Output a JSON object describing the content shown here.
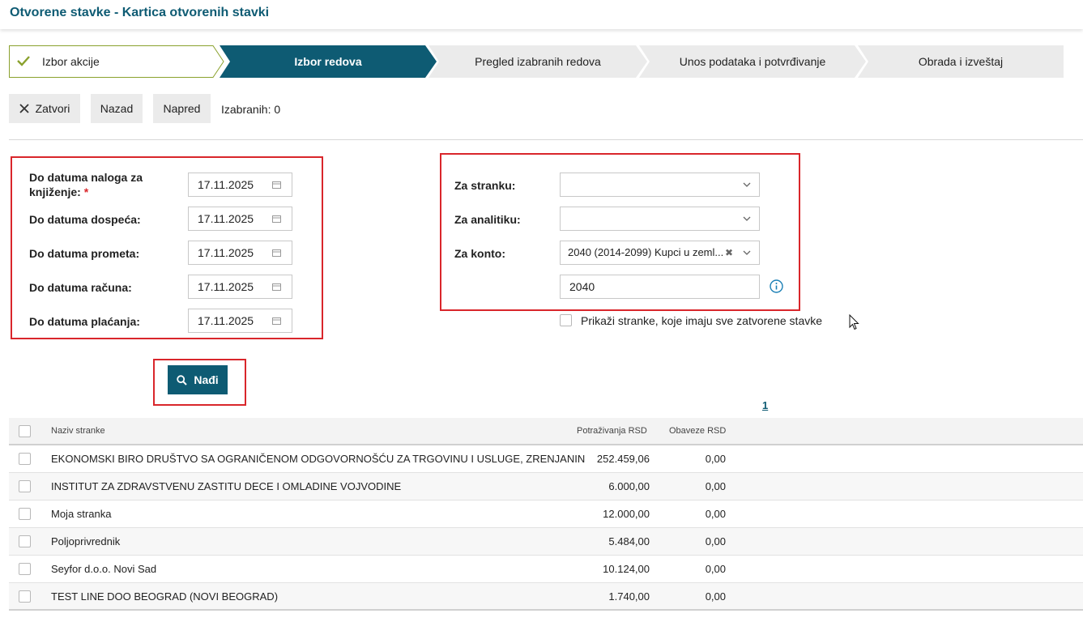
{
  "page": {
    "title": "Otvorene stavke - Kartica otvorenih stavki"
  },
  "wizard": {
    "steps": [
      {
        "label": "Izbor akcije",
        "state": "done"
      },
      {
        "label": "Izbor redova",
        "state": "active"
      },
      {
        "label": "Pregled izabranih redova",
        "state": "pending"
      },
      {
        "label": "Unos podataka i potvrđivanje",
        "state": "pending"
      },
      {
        "label": "Obrada i izveštaj",
        "state": "pending"
      }
    ]
  },
  "toolbar": {
    "close_label": "Zatvori",
    "back_label": "Nazad",
    "next_label": "Napred",
    "selected_label": "Izabranih: 0"
  },
  "dates": {
    "posting_label_1": "Do datuma naloga za",
    "posting_label_2": "knjiženje:",
    "posting_required": "*",
    "posting_value": "17.11.2025",
    "due_label": "Do datuma dospeća:",
    "due_value": "17.11.2025",
    "turnover_label": "Do datuma prometa:",
    "turnover_value": "17.11.2025",
    "invoice_label": "Do datuma računa:",
    "invoice_value": "17.11.2025",
    "payment_label": "Do datuma plaćanja:",
    "payment_value": "17.11.2025"
  },
  "filters": {
    "party_label": "Za stranku:",
    "party_value": "",
    "analytics_label": "Za analitiku:",
    "analytics_value": "",
    "account_label": "Za konto:",
    "account_value": "2040 (2014-2099) Kupci u zeml...",
    "account_text": "2040",
    "show_closed_label": "Prikaži stranke, koje imaju sve zatvorene stavke"
  },
  "search": {
    "label": "Nađi"
  },
  "pager": {
    "current": "1"
  },
  "table": {
    "headers": {
      "name": "Naziv stranke",
      "receivables": "Potraživanja RSD",
      "payables": "Obaveze RSD"
    },
    "rows": [
      {
        "name": "EKONOMSKI BIRO DRUŠTVO SA OGRANIČENOM ODGOVORNOŠĆU ZA TRGOVINU I USLUGE, ZRENJANIN",
        "receivables": "252.459,06",
        "payables": "0,00"
      },
      {
        "name": "INSTITUT ZA ZDRAVSTVENU ZASTITU DECE I OMLADINE VOJVODINE",
        "receivables": "6.000,00",
        "payables": "0,00"
      },
      {
        "name": "Moja stranka",
        "receivables": "12.000,00",
        "payables": "0,00"
      },
      {
        "name": "Poljoprivrednik",
        "receivables": "5.484,00",
        "payables": "0,00"
      },
      {
        "name": "Seyfor d.o.o. Novi Sad",
        "receivables": "10.124,00",
        "payables": "0,00"
      },
      {
        "name": "TEST LINE DOO BEOGRAD (NOVI BEOGRAD)",
        "receivables": "1.740,00",
        "payables": "0,00"
      }
    ]
  },
  "colors": {
    "accent": "#0e5b73",
    "highlight": "#d9262b",
    "done_border": "#8aa12d"
  }
}
